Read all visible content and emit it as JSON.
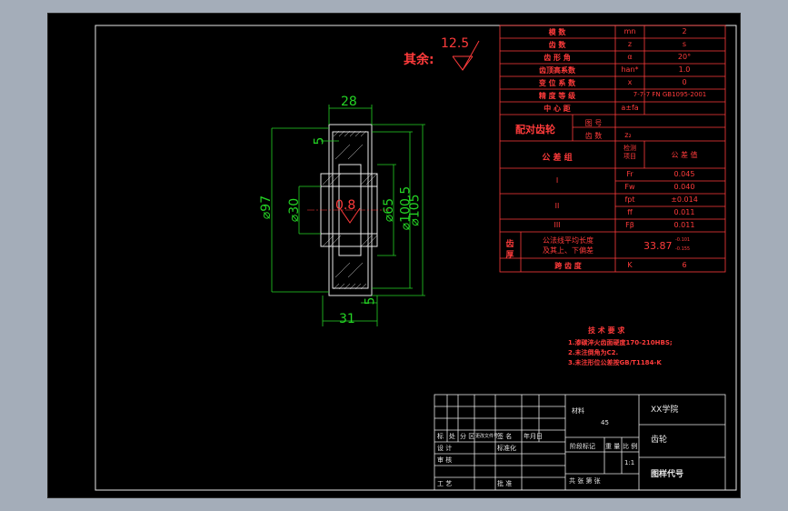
{
  "param_table": {
    "rows": [
      {
        "name": "模  数",
        "sym": "mn",
        "val": "2"
      },
      {
        "name": "齿  数",
        "sym": "z",
        "val": "s"
      },
      {
        "name": "齿 形 角",
        "sym": "α",
        "val": "20°"
      },
      {
        "name": "齿顶高系数",
        "sym": "han*",
        "val": "1.0"
      },
      {
        "name": "变 位 系 数",
        "sym": "x",
        "val": "0"
      },
      {
        "name": "精 度 等 级",
        "sym": "",
        "val": "7-7-7 FN GB1095-2001"
      },
      {
        "name": "中 心 距",
        "sym": "a±fa",
        "val": ""
      }
    ],
    "mating_label": "配对齿轮",
    "mating_rows": [
      {
        "name": "图 号",
        "val": ""
      },
      {
        "name": "齿 数",
        "val": "z₂"
      }
    ],
    "tol_header": {
      "group": "公 差 组",
      "item": "检测\n项目",
      "value": "公 差 值"
    },
    "tol_rows": [
      {
        "group": "I",
        "sym": "Fr",
        "val": "0.045"
      },
      {
        "group": "",
        "sym": "Fw",
        "val": "0.040"
      },
      {
        "group": "II",
        "sym": "fpt",
        "val": "±0.014"
      },
      {
        "group": "",
        "sym": "ff",
        "val": "0.011"
      },
      {
        "group": "III",
        "sym": "Fβ",
        "val": "0.011"
      }
    ],
    "thickness_label": "齿\n厚",
    "thickness_desc": "公法线平均长度\n及其上、下偏差",
    "thickness_val": "33.87",
    "thickness_dev_up": "-0.101",
    "thickness_dev_low": "-0.155",
    "span_label": "跨 齿 度",
    "span_sym": "K",
    "span_val": "6"
  },
  "roughness": {
    "label": "其余:",
    "value": "12.5",
    "section_value": "0.8"
  },
  "dims": {
    "d28": "28",
    "d31": "31",
    "d97": "⌀97",
    "d30": "⌀30",
    "d65": "⌀65",
    "d100": "⌀100.5",
    "d105": "⌀105",
    "d5a": "5",
    "d5b": "5"
  },
  "tech_req": {
    "title": "技 术 要 求",
    "items": [
      "1.渗碳淬火齿面硬度170-210HBS;",
      "2.未注倒角为C2.",
      "3.未注形位公差按GB/T1184-K"
    ]
  },
  "title_block": {
    "material_label": "材料",
    "material_value": "45",
    "school": "XX学院",
    "part_name": "齿轮",
    "drawing_no": "图样代号",
    "header_cells": [
      "标",
      "处",
      "分 区",
      "更改文件号",
      "签 名",
      "年月日"
    ],
    "row_design": "设 计",
    "row_std": "标准化",
    "row_check": "审 核",
    "row_craft": "工 艺",
    "row_approve": "批 准",
    "stage_label": "阶段标记",
    "weight_label": "重 量",
    "scale_label": "比 例",
    "scale_value": "1:1",
    "sheets_label": "共    张  第    张"
  }
}
